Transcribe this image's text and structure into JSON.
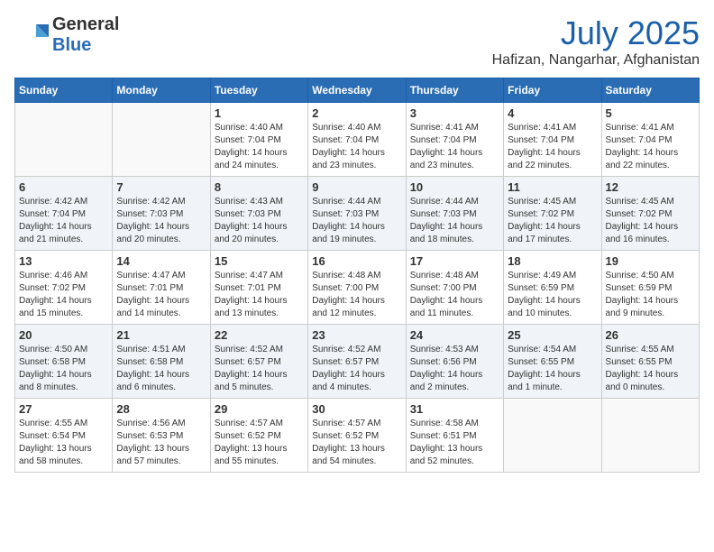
{
  "header": {
    "logo_general": "General",
    "logo_blue": "Blue",
    "month": "July 2025",
    "location": "Hafizan, Nangarhar, Afghanistan"
  },
  "days_of_week": [
    "Sunday",
    "Monday",
    "Tuesday",
    "Wednesday",
    "Thursday",
    "Friday",
    "Saturday"
  ],
  "weeks": [
    [
      {
        "day": "",
        "sunrise": "",
        "sunset": "",
        "daylight": ""
      },
      {
        "day": "",
        "sunrise": "",
        "sunset": "",
        "daylight": ""
      },
      {
        "day": "1",
        "sunrise": "Sunrise: 4:40 AM",
        "sunset": "Sunset: 7:04 PM",
        "daylight": "Daylight: 14 hours and 24 minutes."
      },
      {
        "day": "2",
        "sunrise": "Sunrise: 4:40 AM",
        "sunset": "Sunset: 7:04 PM",
        "daylight": "Daylight: 14 hours and 23 minutes."
      },
      {
        "day": "3",
        "sunrise": "Sunrise: 4:41 AM",
        "sunset": "Sunset: 7:04 PM",
        "daylight": "Daylight: 14 hours and 23 minutes."
      },
      {
        "day": "4",
        "sunrise": "Sunrise: 4:41 AM",
        "sunset": "Sunset: 7:04 PM",
        "daylight": "Daylight: 14 hours and 22 minutes."
      },
      {
        "day": "5",
        "sunrise": "Sunrise: 4:41 AM",
        "sunset": "Sunset: 7:04 PM",
        "daylight": "Daylight: 14 hours and 22 minutes."
      }
    ],
    [
      {
        "day": "6",
        "sunrise": "Sunrise: 4:42 AM",
        "sunset": "Sunset: 7:04 PM",
        "daylight": "Daylight: 14 hours and 21 minutes."
      },
      {
        "day": "7",
        "sunrise": "Sunrise: 4:42 AM",
        "sunset": "Sunset: 7:03 PM",
        "daylight": "Daylight: 14 hours and 20 minutes."
      },
      {
        "day": "8",
        "sunrise": "Sunrise: 4:43 AM",
        "sunset": "Sunset: 7:03 PM",
        "daylight": "Daylight: 14 hours and 20 minutes."
      },
      {
        "day": "9",
        "sunrise": "Sunrise: 4:44 AM",
        "sunset": "Sunset: 7:03 PM",
        "daylight": "Daylight: 14 hours and 19 minutes."
      },
      {
        "day": "10",
        "sunrise": "Sunrise: 4:44 AM",
        "sunset": "Sunset: 7:03 PM",
        "daylight": "Daylight: 14 hours and 18 minutes."
      },
      {
        "day": "11",
        "sunrise": "Sunrise: 4:45 AM",
        "sunset": "Sunset: 7:02 PM",
        "daylight": "Daylight: 14 hours and 17 minutes."
      },
      {
        "day": "12",
        "sunrise": "Sunrise: 4:45 AM",
        "sunset": "Sunset: 7:02 PM",
        "daylight": "Daylight: 14 hours and 16 minutes."
      }
    ],
    [
      {
        "day": "13",
        "sunrise": "Sunrise: 4:46 AM",
        "sunset": "Sunset: 7:02 PM",
        "daylight": "Daylight: 14 hours and 15 minutes."
      },
      {
        "day": "14",
        "sunrise": "Sunrise: 4:47 AM",
        "sunset": "Sunset: 7:01 PM",
        "daylight": "Daylight: 14 hours and 14 minutes."
      },
      {
        "day": "15",
        "sunrise": "Sunrise: 4:47 AM",
        "sunset": "Sunset: 7:01 PM",
        "daylight": "Daylight: 14 hours and 13 minutes."
      },
      {
        "day": "16",
        "sunrise": "Sunrise: 4:48 AM",
        "sunset": "Sunset: 7:00 PM",
        "daylight": "Daylight: 14 hours and 12 minutes."
      },
      {
        "day": "17",
        "sunrise": "Sunrise: 4:48 AM",
        "sunset": "Sunset: 7:00 PM",
        "daylight": "Daylight: 14 hours and 11 minutes."
      },
      {
        "day": "18",
        "sunrise": "Sunrise: 4:49 AM",
        "sunset": "Sunset: 6:59 PM",
        "daylight": "Daylight: 14 hours and 10 minutes."
      },
      {
        "day": "19",
        "sunrise": "Sunrise: 4:50 AM",
        "sunset": "Sunset: 6:59 PM",
        "daylight": "Daylight: 14 hours and 9 minutes."
      }
    ],
    [
      {
        "day": "20",
        "sunrise": "Sunrise: 4:50 AM",
        "sunset": "Sunset: 6:58 PM",
        "daylight": "Daylight: 14 hours and 8 minutes."
      },
      {
        "day": "21",
        "sunrise": "Sunrise: 4:51 AM",
        "sunset": "Sunset: 6:58 PM",
        "daylight": "Daylight: 14 hours and 6 minutes."
      },
      {
        "day": "22",
        "sunrise": "Sunrise: 4:52 AM",
        "sunset": "Sunset: 6:57 PM",
        "daylight": "Daylight: 14 hours and 5 minutes."
      },
      {
        "day": "23",
        "sunrise": "Sunrise: 4:52 AM",
        "sunset": "Sunset: 6:57 PM",
        "daylight": "Daylight: 14 hours and 4 minutes."
      },
      {
        "day": "24",
        "sunrise": "Sunrise: 4:53 AM",
        "sunset": "Sunset: 6:56 PM",
        "daylight": "Daylight: 14 hours and 2 minutes."
      },
      {
        "day": "25",
        "sunrise": "Sunrise: 4:54 AM",
        "sunset": "Sunset: 6:55 PM",
        "daylight": "Daylight: 14 hours and 1 minute."
      },
      {
        "day": "26",
        "sunrise": "Sunrise: 4:55 AM",
        "sunset": "Sunset: 6:55 PM",
        "daylight": "Daylight: 14 hours and 0 minutes."
      }
    ],
    [
      {
        "day": "27",
        "sunrise": "Sunrise: 4:55 AM",
        "sunset": "Sunset: 6:54 PM",
        "daylight": "Daylight: 13 hours and 58 minutes."
      },
      {
        "day": "28",
        "sunrise": "Sunrise: 4:56 AM",
        "sunset": "Sunset: 6:53 PM",
        "daylight": "Daylight: 13 hours and 57 minutes."
      },
      {
        "day": "29",
        "sunrise": "Sunrise: 4:57 AM",
        "sunset": "Sunset: 6:52 PM",
        "daylight": "Daylight: 13 hours and 55 minutes."
      },
      {
        "day": "30",
        "sunrise": "Sunrise: 4:57 AM",
        "sunset": "Sunset: 6:52 PM",
        "daylight": "Daylight: 13 hours and 54 minutes."
      },
      {
        "day": "31",
        "sunrise": "Sunrise: 4:58 AM",
        "sunset": "Sunset: 6:51 PM",
        "daylight": "Daylight: 13 hours and 52 minutes."
      },
      {
        "day": "",
        "sunrise": "",
        "sunset": "",
        "daylight": ""
      },
      {
        "day": "",
        "sunrise": "",
        "sunset": "",
        "daylight": ""
      }
    ]
  ]
}
